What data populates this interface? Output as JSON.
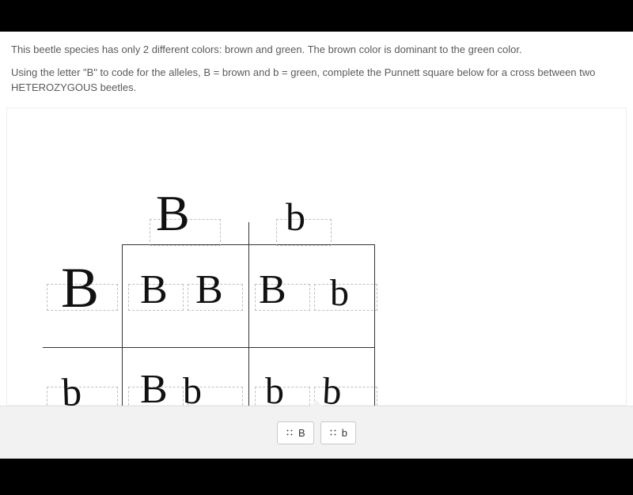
{
  "intro": {
    "line1": "This beetle species has only 2 different colors: brown and green. The brown color is dominant to the green color.",
    "line2": "Using the letter \"B\" to code for the alleles, B = brown and b = green, complete the Punnett square below for a cross between two HETEROZYGOUS beetles."
  },
  "punnett": {
    "top_alleles": [
      "B",
      "b"
    ],
    "left_alleles": [
      "B",
      "b"
    ],
    "cells": [
      [
        "BB",
        "Bb"
      ],
      [
        "Bb",
        "bb"
      ]
    ]
  },
  "handwriting": {
    "top_left": "B",
    "top_right": "b",
    "side_top": "B",
    "side_bottom": "b",
    "cell_00_a": "B",
    "cell_00_b": "B",
    "cell_01_a": "B",
    "cell_01_b": "b",
    "cell_10_a": "B",
    "cell_10_b": "b",
    "cell_11_a": "b",
    "cell_11_b": "b"
  },
  "toolbar": {
    "tile_B": "B",
    "tile_b": "b"
  }
}
